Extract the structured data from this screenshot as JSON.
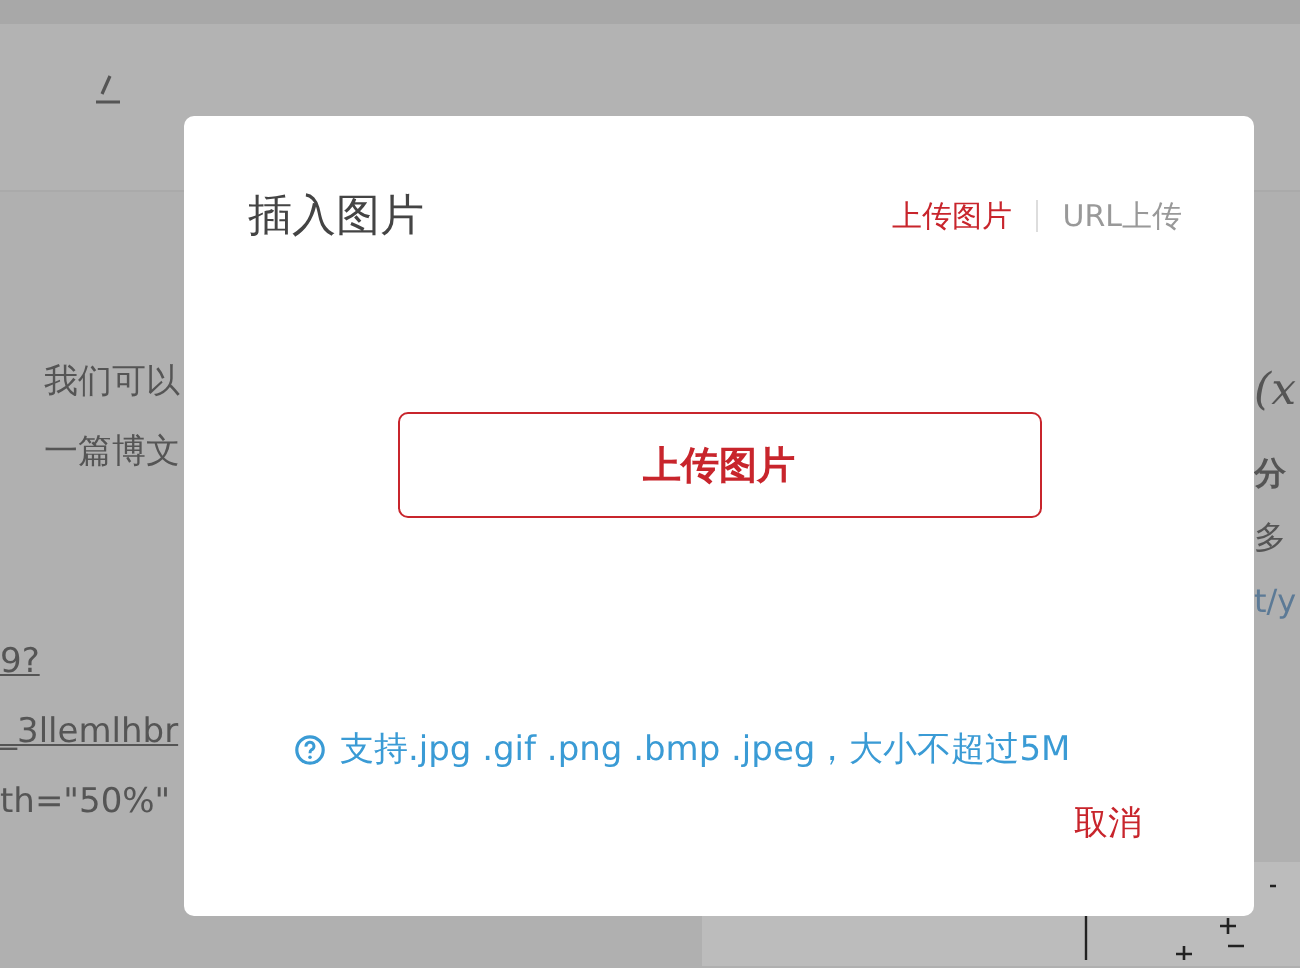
{
  "editor": {
    "left_lines": [
      "我们可以",
      "一篇博文",
      "9?",
      "_3llemlhbr",
      "th=\"50%\""
    ],
    "right_lines": [
      {
        "kind": "formula",
        "text": "(x"
      },
      {
        "kind": "bold",
        "text": "分"
      },
      {
        "kind": "plain",
        "text": "多"
      },
      {
        "kind": "link",
        "text": "t/y"
      }
    ]
  },
  "dialog": {
    "title": "插入图片",
    "tabs": [
      {
        "label": "上传图片",
        "selected": true
      },
      {
        "label": "URL上传",
        "selected": false
      }
    ],
    "upload_button": "上传图片",
    "hint": "支持.jpg .gif .png .bmp .jpeg，大小不超过5M",
    "cancel": "取消"
  }
}
